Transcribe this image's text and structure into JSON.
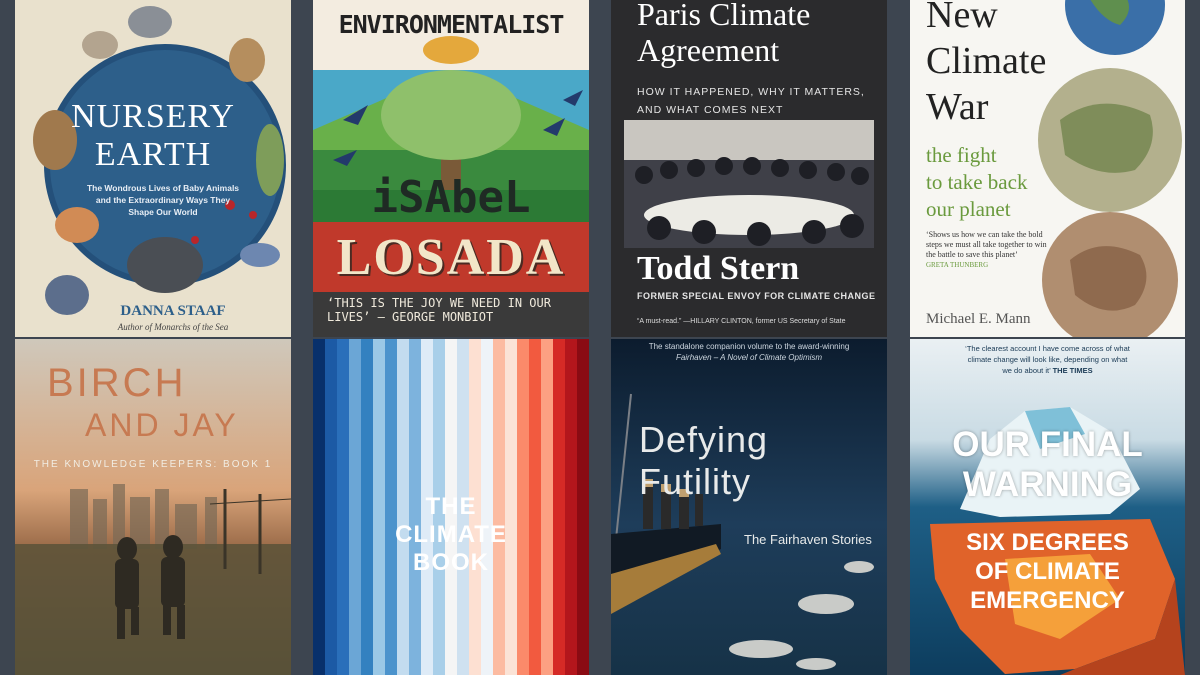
{
  "books": [
    {
      "title_line1": "NURSERY",
      "title_line2": "EARTH",
      "subtitle": "The Wondrous Lives of Baby Animals and the Extraordinary Ways They Shape Our World",
      "author": "DANNA STAAF",
      "author_note": "Author of Monarchs of the Sea"
    },
    {
      "title": "ENVIRONMENTALIST",
      "author_first": "iSAbeL",
      "author_last": "LOSADA",
      "quote": "‘This is the joy we need in our lives’ — George Monbiot"
    },
    {
      "title_line1": "Paris Climate",
      "title_line2": "Agreement",
      "subtitle_line1": "HOW IT HAPPENED, WHY IT MATTERS,",
      "subtitle_line2": "AND WHAT COMES NEXT",
      "author": "Todd Stern",
      "author_role": "FORMER SPECIAL ENVOY FOR CLIMATE CHANGE",
      "blurb": "“A must-read.” —HILLARY CLINTON, former US Secretary of State"
    },
    {
      "title_line1": "New",
      "title_line2": "Climate",
      "title_line3": "War",
      "subtitle_line1": "the fight",
      "subtitle_line2": "to take back",
      "subtitle_line3": "our planet",
      "blurb": "‘Shows us how we can take the bold steps we must all take together to win the battle to save this planet’",
      "blurb_source": "GRETA THUNBERG",
      "author": "Michael E. Mann"
    },
    {
      "title_line1": "BIRCH",
      "title_line2": "AND JAY",
      "series": "THE KNOWLEDGE KEEPERS: BOOK 1"
    },
    {
      "title_line1": "THE",
      "title_line2": "CLIMATE",
      "title_line3": "BOOK"
    },
    {
      "top_line1": "The standalone companion volume to the award-winning",
      "top_line2": "Fairhaven – A Novel of Climate Optimism",
      "title": "Defying Futility",
      "subtitle": "The Fairhaven Stories"
    },
    {
      "quote_line1": "‘The clearest account I have come across of what",
      "quote_line2": "climate change will look like, depending on what",
      "quote_line3": "we do about it’",
      "quote_source": "THE TIMES",
      "title_line1": "OUR FINAL",
      "title_line2": "WARNING",
      "subtitle_line1": "SIX DEGREES",
      "subtitle_line2": "OF CLIMATE",
      "subtitle_line3": "EMERGENCY"
    }
  ],
  "colors": {
    "background": "#3d4550",
    "nursery_globe": "#2d5f8a",
    "losada_red": "#c0392b",
    "paris_dark": "#2b2b2d",
    "birch_title": "#c77a52",
    "warning_orange": "#e0632a"
  }
}
